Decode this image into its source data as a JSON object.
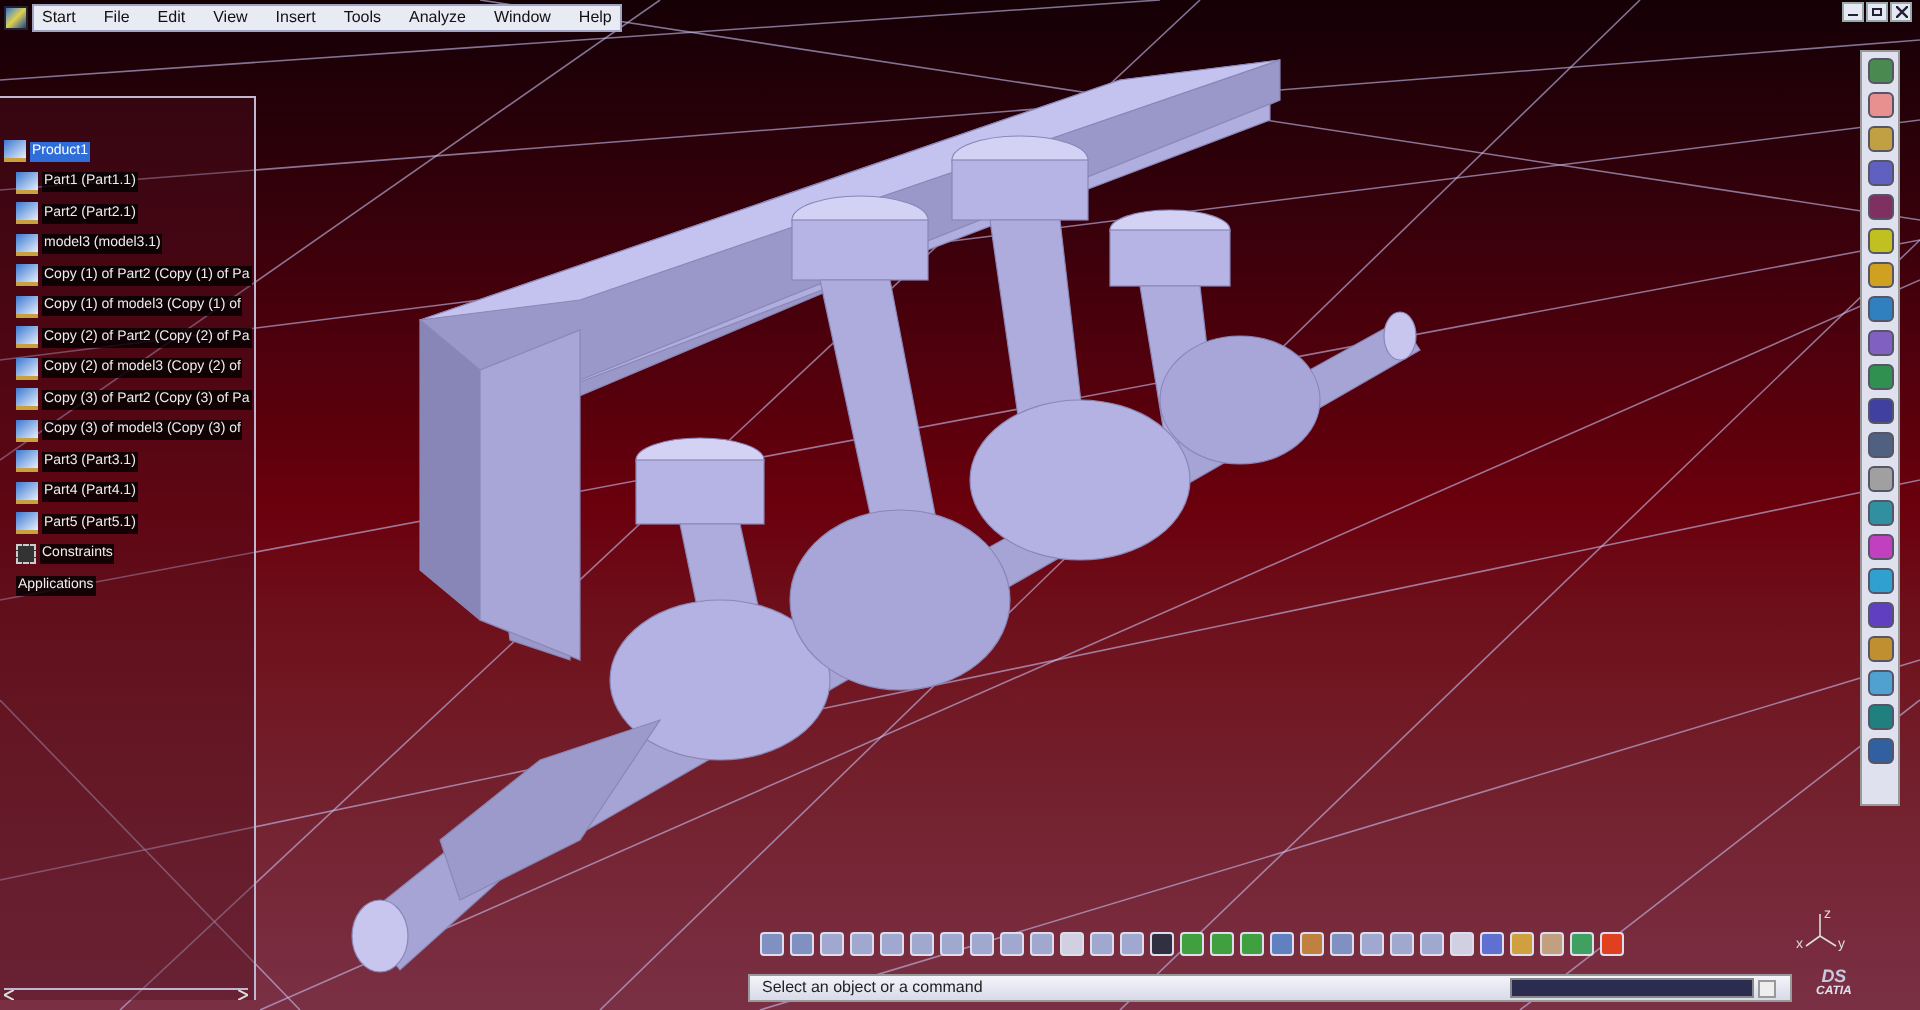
{
  "menu_bar": {
    "items": [
      "Start",
      "File",
      "Edit",
      "View",
      "Insert",
      "Tools",
      "Analyze",
      "Window",
      "Help"
    ]
  },
  "specification_tree": {
    "root": {
      "label": "Product1",
      "selected": true,
      "children": [
        {
          "label": "Part1 (Part1.1)",
          "kind": "part",
          "selected": false
        },
        {
          "label": "Part2 (Part2.1)",
          "kind": "part",
          "selected": false
        },
        {
          "label": "model3 (model3.1)",
          "kind": "part",
          "selected": false
        },
        {
          "label": "Copy (1) of Part2 (Copy (1) of Pa",
          "kind": "part",
          "selected": false
        },
        {
          "label": "Copy (1) of model3 (Copy (1) of",
          "kind": "part",
          "selected": false
        },
        {
          "label": "Copy (2) of Part2 (Copy (2) of Pa",
          "kind": "part",
          "selected": false
        },
        {
          "label": "Copy (2) of model3 (Copy (2) of",
          "kind": "part",
          "selected": false
        },
        {
          "label": "Copy (3) of Part2 (Copy (3) of Pa",
          "kind": "part",
          "selected": false
        },
        {
          "label": "Copy (3) of model3 (Copy (3) of",
          "kind": "part",
          "selected": false
        },
        {
          "label": "Part3 (Part3.1)",
          "kind": "part",
          "selected": false
        },
        {
          "label": "Part4 (Part4.1)",
          "kind": "part",
          "selected": false
        },
        {
          "label": "Part5 (Part5.1)",
          "kind": "part",
          "selected": false
        },
        {
          "label": "Constraints",
          "kind": "constraints",
          "selected": false
        },
        {
          "label": "Applications",
          "kind": "applications",
          "selected": false
        }
      ]
    }
  },
  "compass": {
    "axes": [
      "x",
      "y",
      "z"
    ]
  },
  "status_bar": {
    "prompt": "Select an object or a command"
  },
  "logo": {
    "text": "CATIA",
    "mark": "DS"
  }
}
